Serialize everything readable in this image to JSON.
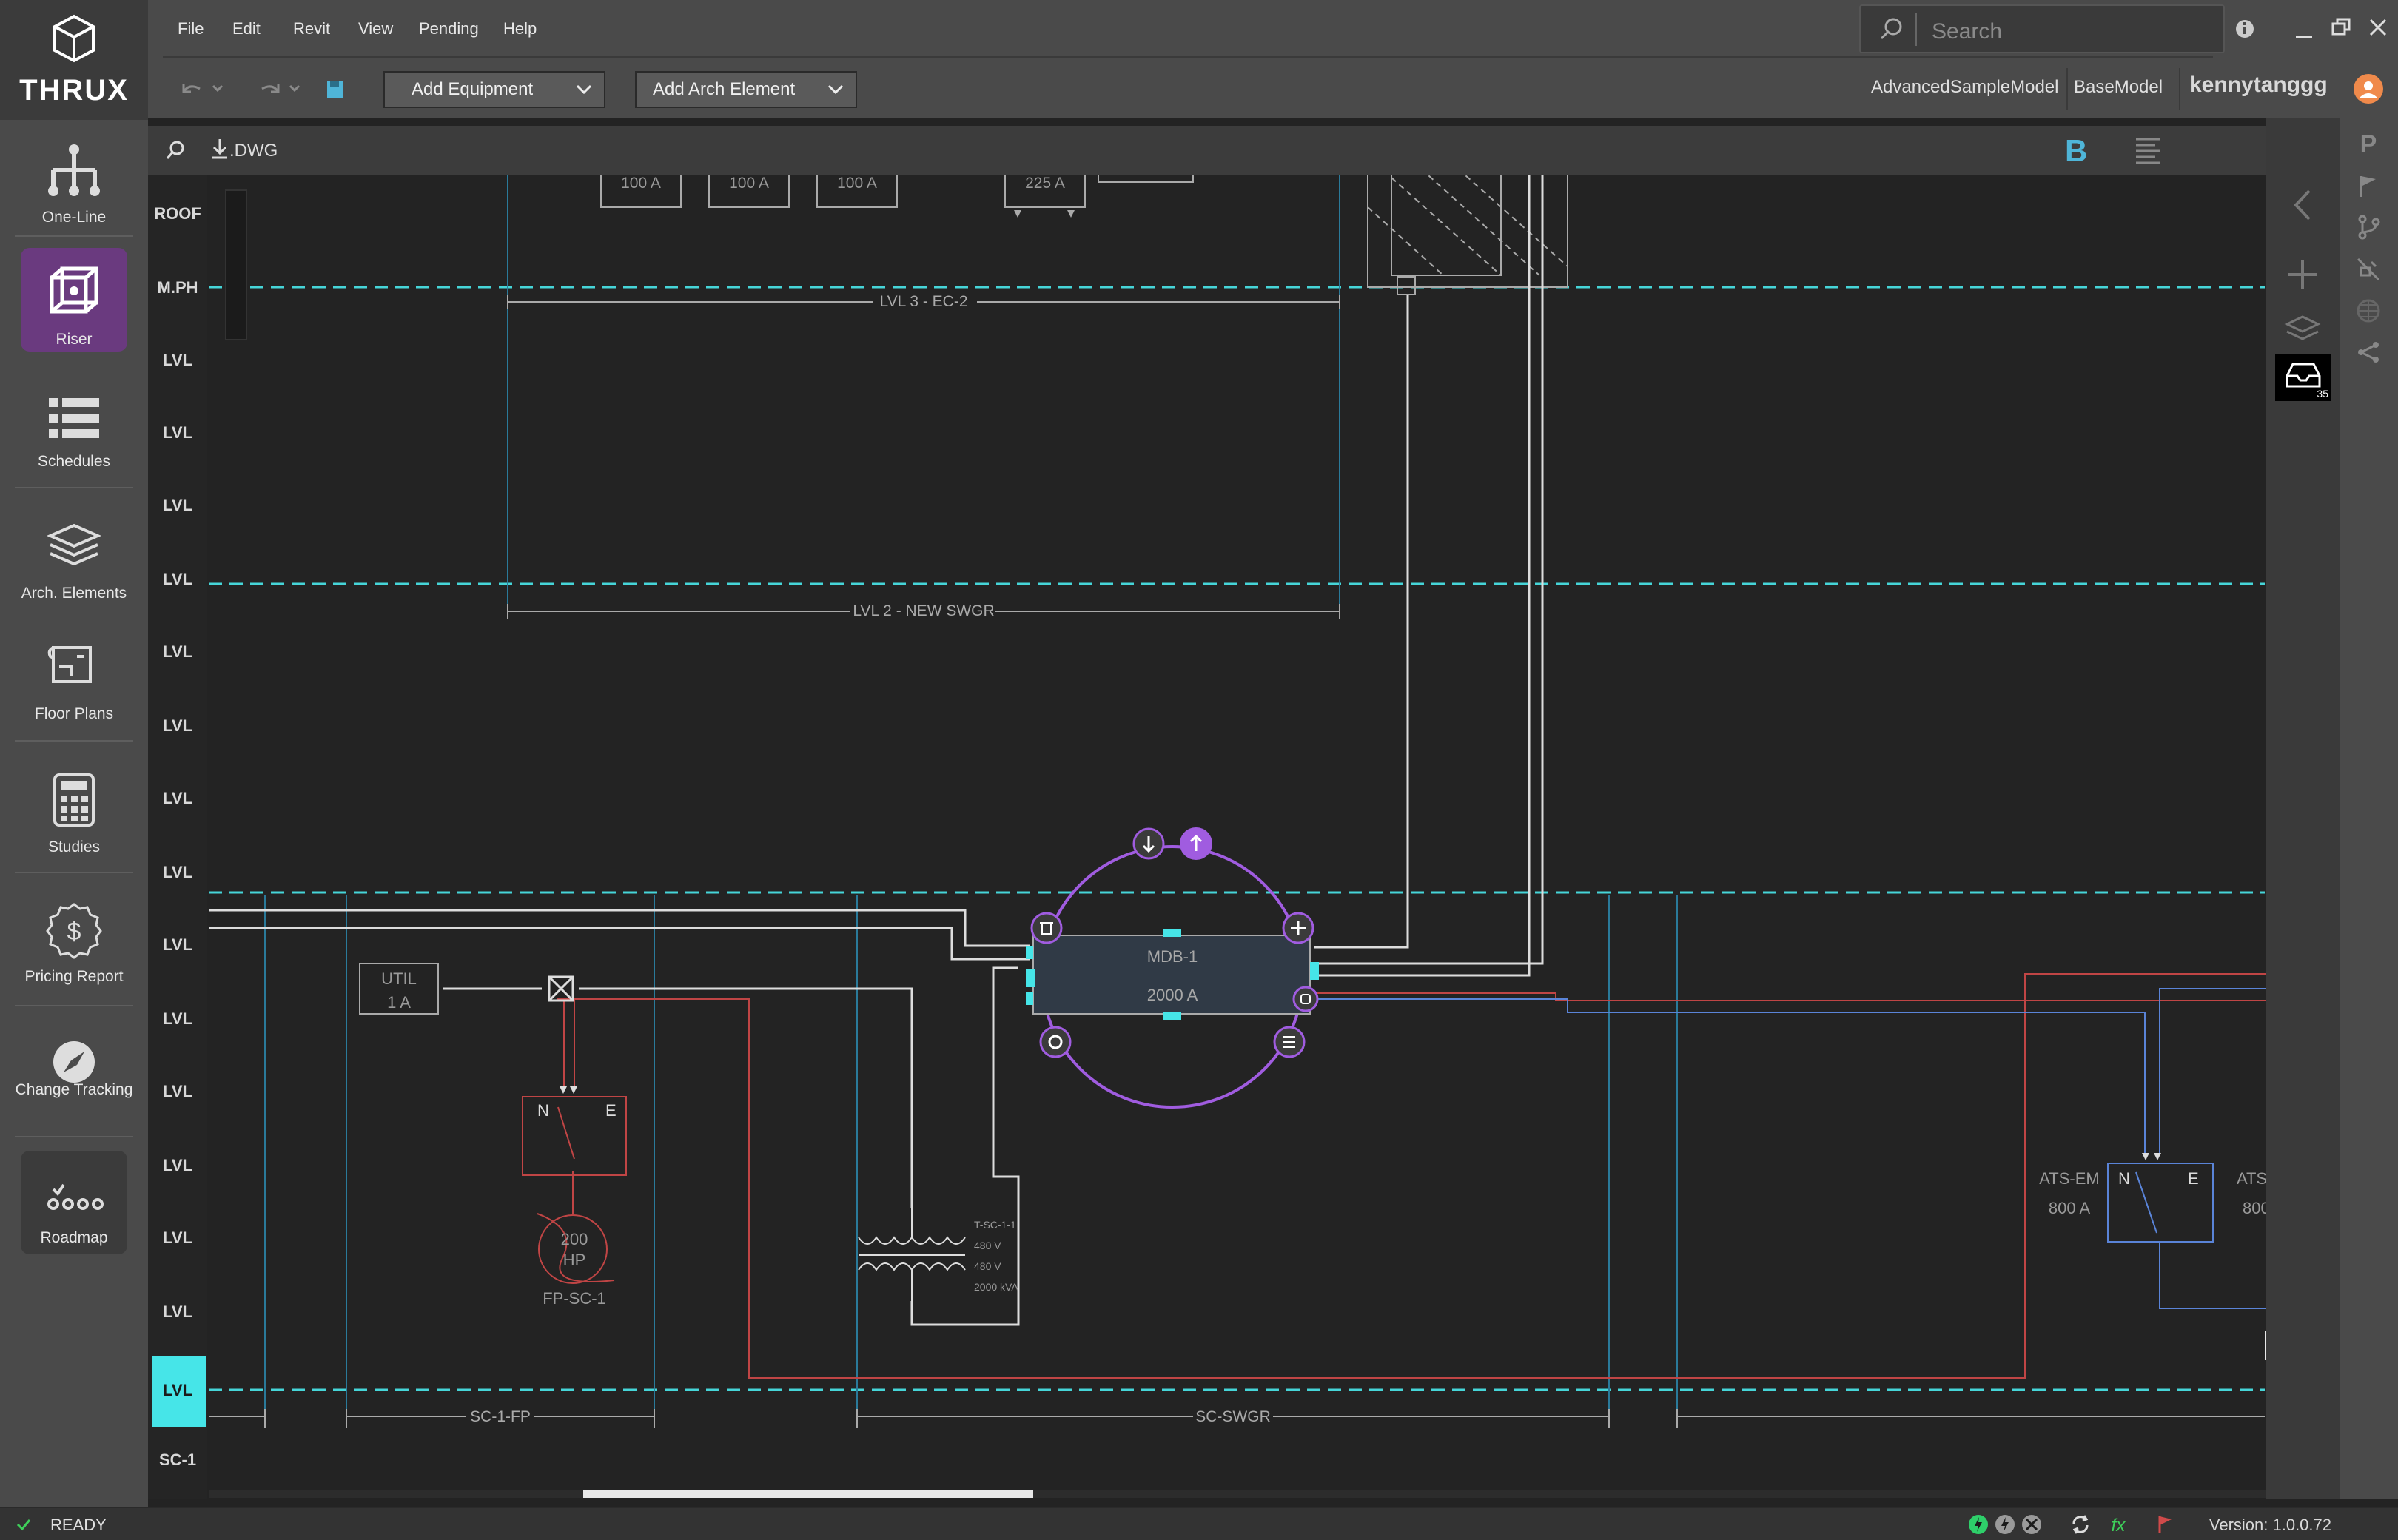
{
  "app": {
    "logo_text": "THRUX"
  },
  "menu": [
    "File",
    "Edit",
    "Revit",
    "View",
    "Pending",
    "Help"
  ],
  "toolbar": {
    "add_equipment": "Add Equipment",
    "add_arch": "Add Arch Element"
  },
  "search": {
    "placeholder": "Search"
  },
  "models": {
    "advanced": "AdvancedSampleModel",
    "base": "BaseModel"
  },
  "user": {
    "name": "kennytanggg"
  },
  "nav": [
    {
      "label": "One-Line",
      "icon": "hierarchy-icon"
    },
    {
      "label": "Riser",
      "icon": "cube-icon",
      "active": true
    },
    {
      "label": "Schedules",
      "icon": "list-icon"
    },
    {
      "label": "Arch. Elements",
      "icon": "layers-icon"
    },
    {
      "label": "Floor Plans",
      "icon": "map-icon"
    },
    {
      "label": "Studies",
      "icon": "calculator-icon"
    },
    {
      "label": "Pricing Report",
      "icon": "dollar-badge-icon"
    },
    {
      "label": "Change Tracking",
      "icon": "compass-icon"
    },
    {
      "label": "Roadmap",
      "icon": "roadmap-icon"
    }
  ],
  "canvasbar": {
    "dwg": ".DWG",
    "b": "B"
  },
  "levels": [
    "ROOF",
    "M.PH",
    "LVL",
    "LVL",
    "LVL",
    "LVL",
    "LVL",
    "LVL",
    "LVL",
    "LVL",
    "LVL",
    "LVL",
    "LVL",
    "LVL",
    "LVL",
    "LVL",
    "LVL",
    "SC-1"
  ],
  "diagram": {
    "breakers": [
      "100 A",
      "100 A",
      "100 A",
      "225 A"
    ],
    "ec2": "LVL 3 - EC-2",
    "swgr": "LVL 2 - NEW SWGR",
    "util_name": "UTIL",
    "util_rating": "1 A",
    "ats_n": "N",
    "ats_e": "E",
    "motor_hp": "200",
    "motor_unit": "HP",
    "motor_name": "FP-SC-1",
    "mdb_name": "MDB-1",
    "mdb_rating": "2000 A",
    "xfmr": [
      "T-SC-1-1",
      "480 V",
      "480 V",
      "2000 kVA"
    ],
    "ats_em_name": "ATS-EM",
    "ats_em_rating": "800 A",
    "ats2_name": "ATS-",
    "ats2_rating": "800",
    "sc1fp": "SC-1-FP",
    "scswgr": "SC-SWGR"
  },
  "rightpanel": {
    "badge": "35"
  },
  "status": {
    "text": "READY",
    "version": "Version: 1.0.0.72"
  }
}
